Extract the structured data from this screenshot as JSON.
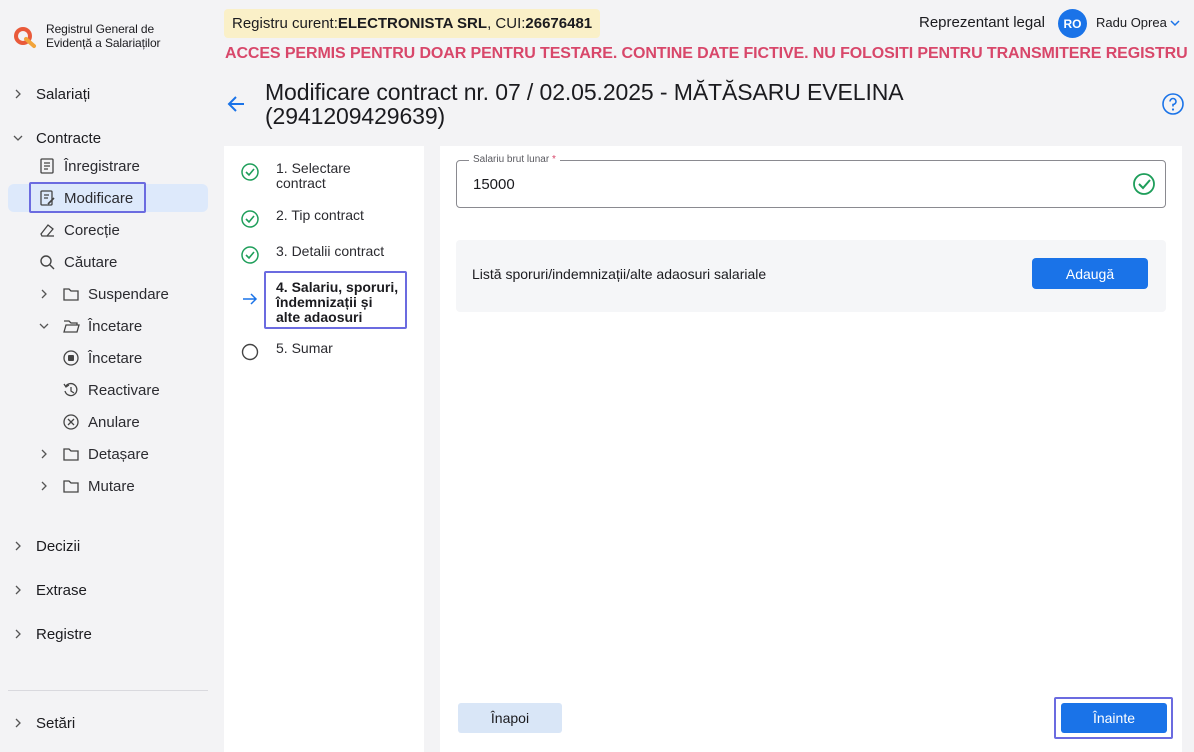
{
  "sidebar": {
    "logo_line1": "Registrul General de",
    "logo_line2": "Evidență a Salariaților",
    "salariati": "Salariați",
    "contracte": "Contracte",
    "inregistrare": "Înregistrare",
    "modificare": "Modificare",
    "corectie": "Corecție",
    "cautare": "Căutare",
    "suspendare": "Suspendare",
    "incetare_group": "Încetare",
    "incetare": "Încetare",
    "reactivare": "Reactivare",
    "anulare": "Anulare",
    "detasare": "Detașare",
    "mutare": "Mutare",
    "decizii": "Decizii",
    "extrase": "Extrase",
    "registre": "Registre",
    "setari": "Setări"
  },
  "header": {
    "registry_prefix": "Registru curent: ",
    "company": "ELECTRONISTA SRL",
    "cui_prefix": ", CUI: ",
    "cui": "26676481",
    "warning": "ACCES PERMIS PENTRU DOAR PENTRU TESTARE. CONTINE DATE FICTIVE. NU FOLOSITI PENTRU TRANSMITERE REGISTRU",
    "role": "Reprezentant legal",
    "avatar_initials": "RO",
    "username": "Radu Oprea"
  },
  "page": {
    "title": "Modificare contract nr. 07 / 02.05.2025 - MĂTĂSARU  EVELINA (2941209429639)"
  },
  "steps": [
    {
      "label": "1. Selectare contract",
      "state": "done"
    },
    {
      "label": "2. Tip contract",
      "state": "done"
    },
    {
      "label": "3. Detalii contract",
      "state": "done"
    },
    {
      "label": "4. Salariu, sporuri, îndemnizații și alte adaosuri",
      "state": "current"
    },
    {
      "label": "5. Sumar",
      "state": "pending"
    }
  ],
  "form": {
    "salary_label": "Salariu brut lunar",
    "required_mark": "*",
    "salary_value": "15000",
    "list_title": "Listă sporuri/indemnizații/alte adaosuri salariale",
    "add_label": "Adaugă",
    "back_label": "Înapoi",
    "next_label": "Înainte"
  },
  "colors": {
    "accent": "#1a73e8",
    "warning": "#d8476a",
    "success": "#1e9e5a",
    "focus": "#6b6be0"
  }
}
